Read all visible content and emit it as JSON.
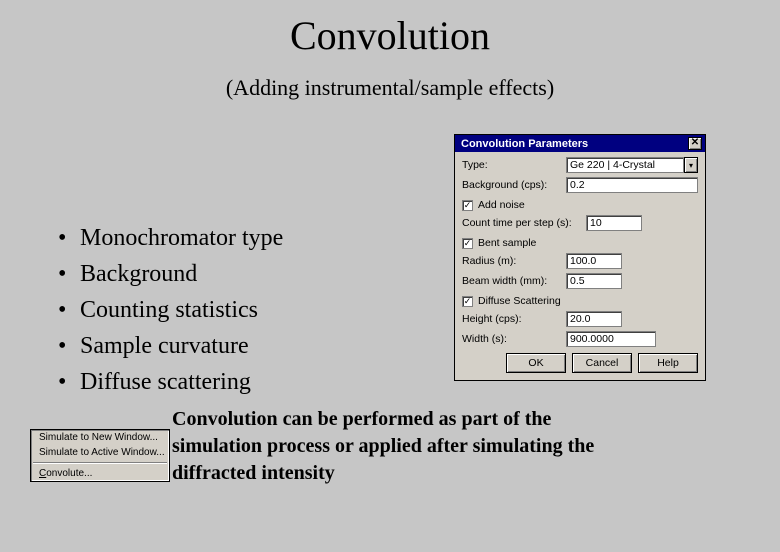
{
  "slide": {
    "title": "Convolution",
    "subtitle": "(Adding instrumental/sample effects)",
    "bullets": [
      "Monochromator type",
      "Background",
      "Counting statistics",
      "Sample curvature",
      "Diffuse scattering"
    ],
    "note": "Convolution can be performed as part of the simulation  process or applied after simulating the diffracted intensity"
  },
  "menu": {
    "items": [
      "Simulate to New Window...",
      "Simulate to Active Window..."
    ],
    "last": "Convolute...",
    "last_underline": "C"
  },
  "dialog": {
    "title": "Convolution Parameters",
    "close_glyph": "✕",
    "type_label": "Type:",
    "type_value": "Ge 220 | 4-Crystal",
    "bg_label": "Background (cps):",
    "bg_value": "0.2",
    "add_noise_label": "Add noise",
    "add_noise_checked": true,
    "count_label": "Count time per step (s):",
    "count_value": "10",
    "bent_label": "Bent sample",
    "bent_checked": true,
    "radius_label": "Radius (m):",
    "radius_value": "100.0",
    "beam_label": "Beam width (mm):",
    "beam_value": "0.5",
    "diffuse_label": "Diffuse Scattering",
    "diffuse_checked": true,
    "height_label": "Height (cps):",
    "height_value": "20.0",
    "width_label": "Width (s):",
    "width_value": "900.0000",
    "ok": "OK",
    "cancel": "Cancel",
    "help": "Help",
    "dd_glyph": "▾"
  }
}
